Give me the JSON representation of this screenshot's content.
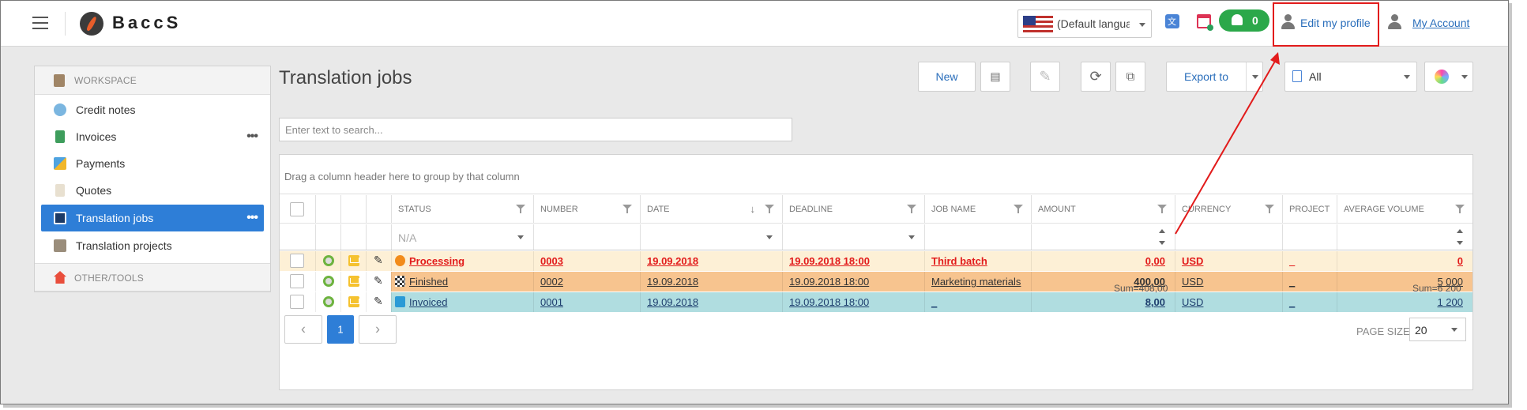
{
  "header": {
    "app_name": "BaccS",
    "language": "(Default language)",
    "notification_count": "0",
    "edit_profile": "Edit my profile",
    "my_account": "My Account",
    "highlight_color": "#e21b1b"
  },
  "sidebar": {
    "workspace_label": "WORKSPACE",
    "other_label": "OTHER/TOOLS",
    "items": [
      {
        "label": "Credit notes",
        "icon": "credit-notes-icon"
      },
      {
        "label": "Invoices",
        "icon": "invoices-icon"
      },
      {
        "label": "Payments",
        "icon": "payments-icon"
      },
      {
        "label": "Quotes",
        "icon": "quotes-icon"
      },
      {
        "label": "Translation jobs",
        "icon": "translation-jobs-icon",
        "active": true
      },
      {
        "label": "Translation projects",
        "icon": "translation-projects-icon"
      }
    ],
    "active_color": "#2e7ed7"
  },
  "main": {
    "title": "Translation jobs",
    "toolbar": {
      "new_label": "New",
      "export_label": "Export to",
      "filter_value": "All"
    },
    "search_placeholder": "Enter text to search...",
    "grid": {
      "group_hint": "Drag a column header here to group by that column",
      "columns": [
        "STATUS",
        "NUMBER",
        "DATE",
        "DEADLINE",
        "JOB NAME",
        "AMOUNT",
        "CURRENCY",
        "PROJECT",
        "AVERAGE VOLUME"
      ],
      "status_filter_placeholder": "N/A",
      "rows": [
        {
          "status": "Processing",
          "number": "0003",
          "date": "19.09.2018",
          "deadline": "19.09.2018 18:00",
          "job_name": "Third batch",
          "amount": "0,00",
          "currency": "USD",
          "project": "_",
          "average_volume": "0",
          "color": "#fdf0d6"
        },
        {
          "status": "Finished",
          "number": "0002",
          "date": "19.09.2018",
          "deadline": "19.09.2018 18:00",
          "job_name": "Marketing materials",
          "amount": "400,00",
          "currency": "USD",
          "project": "_",
          "average_volume": "5 000",
          "color": "#f7c48f"
        },
        {
          "status": "Invoiced",
          "number": "0001",
          "date": "19.09.2018",
          "deadline": "19.09.2018 18:00",
          "job_name": "_",
          "amount": "8,00",
          "currency": "USD",
          "project": "_",
          "average_volume": "1 200",
          "color": "#b0dde0"
        }
      ],
      "sum_amount": "Sum=408,00",
      "sum_volume": "Sum=6 200"
    },
    "pager": {
      "current_page": "1",
      "page_size_label": "PAGE SIZE",
      "page_size": "20"
    }
  }
}
